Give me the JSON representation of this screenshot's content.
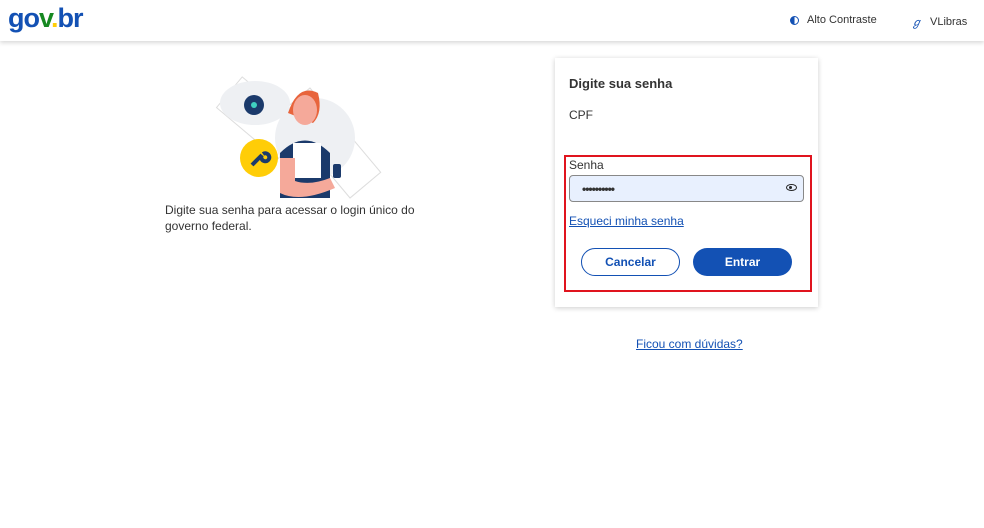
{
  "header": {
    "logo": "gov.br",
    "contrast_label": "Alto Contraste",
    "libras_label": "VLibras"
  },
  "intro": {
    "description": "Digite sua senha para acessar o login único do governo federal."
  },
  "card": {
    "title": "Digite sua senha",
    "cpf_label": "CPF",
    "password_label": "Senha",
    "password_value": "••••••••••",
    "forgot_link": "Esqueci minha senha",
    "cancel_label": "Cancelar",
    "enter_label": "Entrar"
  },
  "help_link": "Ficou com dúvidas?",
  "colors": {
    "primary": "#1351b4",
    "highlight": "#e0141e"
  }
}
